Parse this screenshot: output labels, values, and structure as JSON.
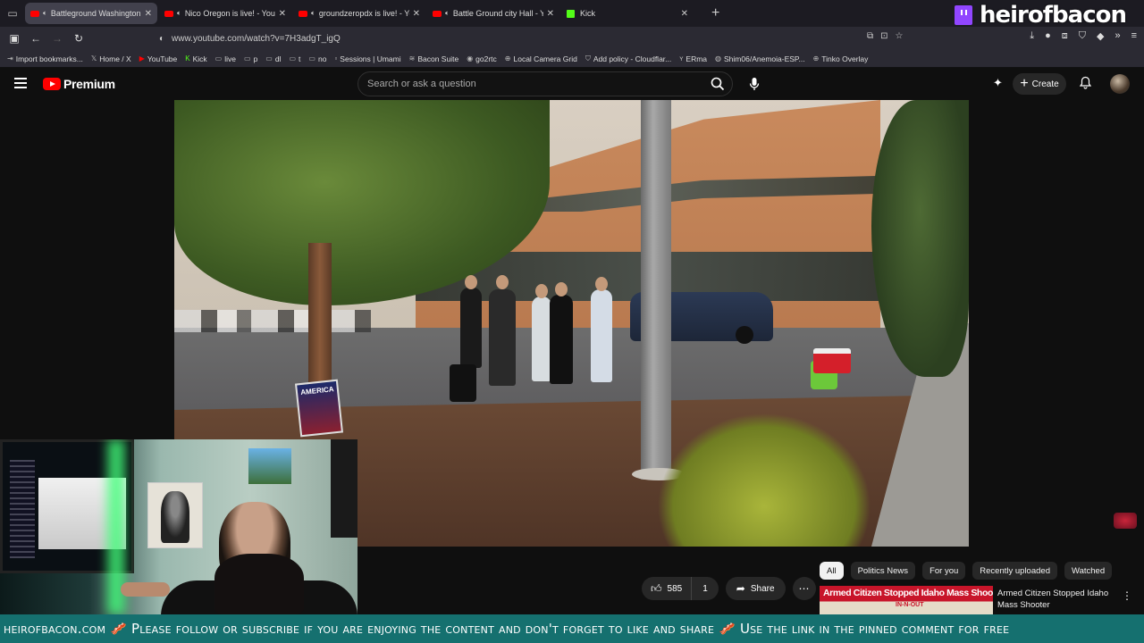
{
  "browser": {
    "tabs": [
      {
        "label": "Battleground Washington",
        "icon": "youtube-icon",
        "active": true,
        "audio": true
      },
      {
        "label": "Nico Oregon is live! - YouTube",
        "icon": "youtube-icon",
        "active": false,
        "audio": true
      },
      {
        "label": "groundzeropdx is live! - YouTube",
        "icon": "youtube-icon",
        "active": false,
        "audio": true
      },
      {
        "label": "Battle Ground city Hall - YouTube",
        "icon": "youtube-icon",
        "active": false,
        "audio": true
      },
      {
        "label": "Kick",
        "icon": "kick-icon",
        "active": false,
        "audio": false
      }
    ],
    "url": "www.youtube.com/watch?v=7H3adgT_igQ",
    "bookmarks": [
      {
        "label": "Import bookmarks...",
        "icon": "import-icon"
      },
      {
        "label": "Home / X",
        "icon": "x-icon"
      },
      {
        "label": "YouTube",
        "icon": "youtube-icon"
      },
      {
        "label": "Kick",
        "icon": "kick-icon"
      },
      {
        "label": "live",
        "icon": "folder-icon"
      },
      {
        "label": "p",
        "icon": "folder-icon"
      },
      {
        "label": "dl",
        "icon": "folder-icon"
      },
      {
        "label": "t",
        "icon": "folder-icon"
      },
      {
        "label": "no",
        "icon": "folder-icon"
      },
      {
        "label": "Sessions | Umami",
        "icon": "page-icon"
      },
      {
        "label": "Bacon Suite",
        "icon": "bacon-icon"
      },
      {
        "label": "go2rtc",
        "icon": "eye-icon"
      },
      {
        "label": "Local Camera Grid",
        "icon": "globe-icon"
      },
      {
        "label": "Add policy - Cloudflar...",
        "icon": "shield-icon"
      },
      {
        "label": "ERma",
        "icon": "ym-icon"
      },
      {
        "label": "Shim06/Anemoia-ESP...",
        "icon": "github-icon"
      },
      {
        "label": "Tinko Overlay",
        "icon": "globe-icon"
      }
    ]
  },
  "overlay": {
    "channel_name": "heirofbacon",
    "ticker": "heirofbacon.com 🥓 Please follow or subscribe if you are enjoying the content and don't forget to like and share 🥓 Use the link in the pinned comment for free"
  },
  "youtube": {
    "logo_text": "Premium",
    "search_placeholder": "Search or ask a question",
    "create_label": "Create",
    "likes": "585",
    "dislikes": "1",
    "share_label": "Share",
    "chips": [
      "All",
      "Politics News",
      "For you",
      "Recently uploaded",
      "Watched"
    ],
    "recommendation": {
      "thumb_text": "Armed Citizen Stopped Idaho Mass Shooter",
      "thumb_sub": "IN-N-OUT",
      "title": "Armed Citizen Stopped Idaho Mass Shooter"
    }
  },
  "video_scene": {
    "sign_text": "AMERICA"
  },
  "colors": {
    "yt_red": "#ff0000",
    "twitch_purple": "#9146ff",
    "kick_green": "#53fc18",
    "ticker_teal": "#15706f"
  }
}
